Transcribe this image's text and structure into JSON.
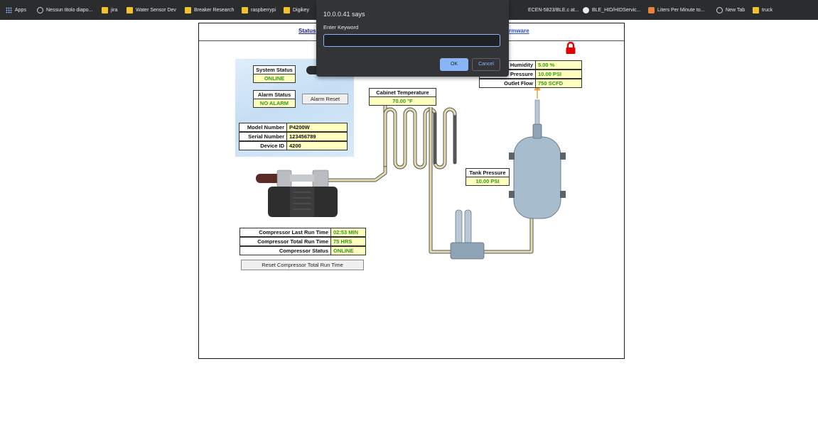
{
  "bookmarks": [
    {
      "label": "Apps",
      "icon": "apps-grid-icon"
    },
    {
      "label": "Nessun titolo diapo...",
      "icon": "globe-icon"
    },
    {
      "label": "jira",
      "icon": "folder-icon"
    },
    {
      "label": "Water Sensor Dev",
      "icon": "folder-icon"
    },
    {
      "label": "Breaker Research",
      "icon": "folder-icon"
    },
    {
      "label": "raspberrypi",
      "icon": "folder-icon"
    },
    {
      "label": "Digikey",
      "icon": "folder-icon"
    },
    {
      "label": "ECEN-5823/BLE.c at...",
      "icon": "page-icon"
    },
    {
      "label": "BLE_HID/HIDServic...",
      "icon": "github-icon"
    },
    {
      "label": "Liters Per Minute to...",
      "icon": "converter-icon"
    },
    {
      "label": "New Tab",
      "icon": "globe-icon"
    },
    {
      "label": "truck",
      "icon": "folder-icon"
    }
  ],
  "nav": {
    "status_label": "Status",
    "firmware_label": "Firmware"
  },
  "system": {
    "system_status_label": "System Status",
    "system_status_value": "ONLINE",
    "alarm_status_label": "Alarm Status",
    "alarm_status_value": "NO ALARM",
    "alarm_reset_label": "Alarm Reset",
    "model_number_label": "Model Number",
    "model_number_value": "P4200W",
    "serial_number_label": "Serial Number",
    "serial_number_value": "123456789",
    "device_id_label": "Device ID",
    "device_id_value": "4200"
  },
  "readings": {
    "cabinet_temperature_label": "Cabinet Temperature",
    "cabinet_temperature_value": "70.00 °F",
    "humidity_label": "Humidity",
    "humidity_value": "5.00 %",
    "pressure_label": "Pressure",
    "pressure_value": "10.00 PSI",
    "outlet_flow_label": "Outlet Flow",
    "outlet_flow_value": "750 SCFD",
    "tank_pressure_label": "Tank Pressure",
    "tank_pressure_value": "10.00 PSI"
  },
  "compressor": {
    "last_run_label": "Compressor Last Run Time",
    "last_run_value": "02:53 MIN",
    "total_run_label": "Compressor Total Run Time",
    "total_run_value": "75 HRS",
    "status_label": "Compressor Status",
    "status_value": "ONLINE",
    "reset_button_label": "Reset Compressor Total Run Time"
  },
  "dialog": {
    "title": "10.0.0.41 says",
    "message": "Enter Keyword",
    "input_value": "",
    "ok_label": "OK",
    "cancel_label": "Cancel"
  },
  "colors": {
    "value_text": "#2f9a1d",
    "value_bg": "#ffffc0",
    "lock": "#e00000",
    "pipe": "#d8cc9a",
    "dialog_bg": "#333437",
    "dialog_accent": "#8ab4f8"
  }
}
